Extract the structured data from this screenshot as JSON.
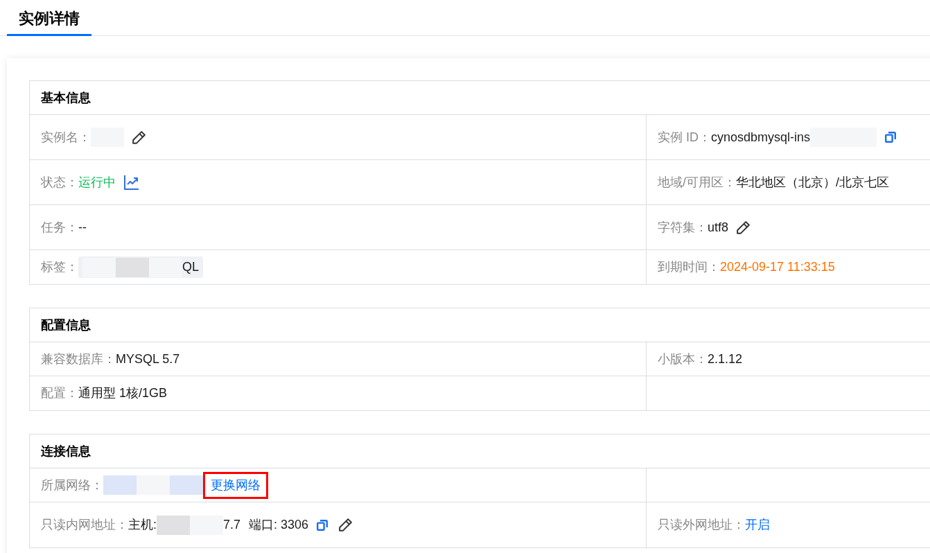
{
  "tabs": [
    {
      "label": "实例详情",
      "selected": true
    }
  ],
  "sections": [
    {
      "title": "基本信息",
      "rows": [
        {
          "cells": [
            {
              "label": "实例名：",
              "parts": [
                {
                  "kind": "redacted_light"
                }
              ],
              "actions": [
                {
                  "kind": "edit"
                }
              ]
            },
            {
              "label": "实例 ID：",
              "parts": [
                {
                  "kind": "text",
                  "text": "cynosdbmysql-ins"
                },
                {
                  "kind": "redacted_light"
                },
                {
                  "kind": "redacted_light"
                }
              ],
              "actions": [
                {
                  "kind": "copy"
                }
              ]
            }
          ]
        },
        {
          "cells": [
            {
              "label": "状态：",
              "parts": [
                {
                  "kind": "success",
                  "text": "运行中"
                }
              ],
              "actions": [
                {
                  "kind": "monitor"
                }
              ]
            },
            {
              "label": "地域/可用区：",
              "parts": [
                {
                  "kind": "text",
                  "text": "华北地区（北京）/北京七区"
                }
              ]
            }
          ]
        },
        {
          "cells": [
            {
              "label": "任务：",
              "parts": [
                {
                  "kind": "text",
                  "text": "--"
                }
              ]
            },
            {
              "label": "字符集：",
              "parts": [
                {
                  "kind": "text",
                  "text": "utf8"
                }
              ],
              "actions": [
                {
                  "kind": "edit"
                }
              ]
            }
          ]
        },
        {
          "cells": [
            {
              "label": "标签：",
              "parts": [
                {
                  "kind": "tag",
                  "parts": [
                    {
                      "kind": "redacted_light"
                    },
                    {
                      "kind": "redacted_gray"
                    },
                    {
                      "kind": "redacted_light"
                    },
                    {
                      "kind": "text",
                      "text": "QL"
                    }
                  ]
                }
              ]
            },
            {
              "label": "到期时间：",
              "parts": [
                {
                  "kind": "warning",
                  "text": "2024-09-17 11:33:15"
                }
              ]
            }
          ]
        }
      ]
    },
    {
      "title": "配置信息",
      "rows": [
        {
          "cells": [
            {
              "label": "兼容数据库：",
              "parts": [
                {
                  "kind": "text",
                  "text": "MYSQL 5.7"
                }
              ]
            },
            {
              "label": "小版本：",
              "parts": [
                {
                  "kind": "text",
                  "text": "2.1.12"
                }
              ]
            }
          ]
        },
        {
          "cells": [
            {
              "label": "配置：",
              "parts": [
                {
                  "kind": "text",
                  "text": "通用型 1核/1GB"
                }
              ]
            }
          ]
        }
      ]
    },
    {
      "title": "连接信息",
      "rows": [
        {
          "cells": [
            {
              "label": "所属网络：",
              "parts": [
                {
                  "kind": "redacted_blue"
                },
                {
                  "kind": "redacted_light"
                },
                {
                  "kind": "redacted_blue"
                },
                {
                  "kind": "link",
                  "text": "更换网络",
                  "highlighted": true
                }
              ]
            }
          ]
        },
        {
          "cells": [
            {
              "label": "只读内网地址：",
              "parts": [
                {
                  "kind": "text",
                  "text": "主机:"
                },
                {
                  "kind": "redacted_gray"
                },
                {
                  "kind": "redacted_light"
                },
                {
                  "kind": "text",
                  "text": "7.7"
                },
                {
                  "kind": "text",
                  "text": "端口: 3306"
                }
              ],
              "actions": [
                {
                  "kind": "copy"
                },
                {
                  "kind": "edit"
                }
              ]
            },
            {
              "label": "只读外网地址：",
              "parts": [
                {
                  "kind": "link",
                  "text": "开启",
                  "highlighted": false
                }
              ]
            }
          ]
        }
      ]
    }
  ]
}
